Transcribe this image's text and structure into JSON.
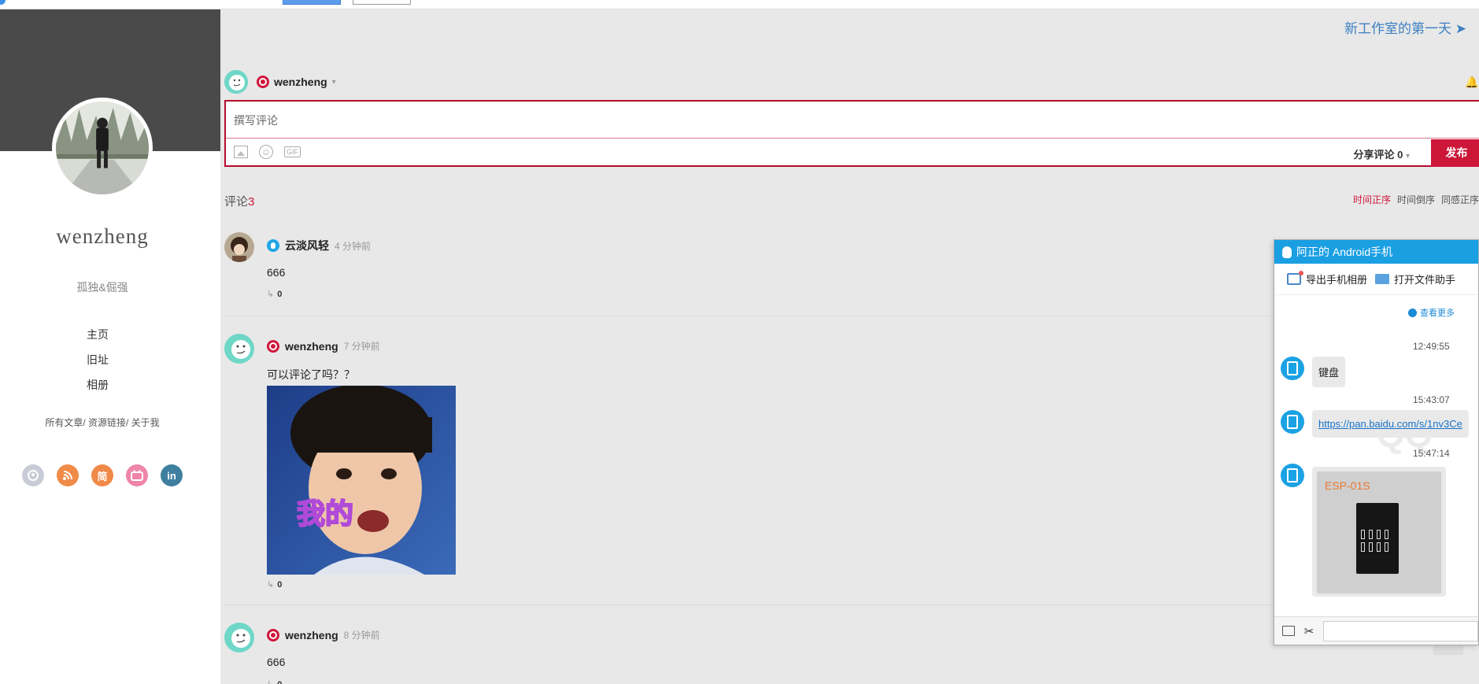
{
  "header": {
    "title_link": "新工作室的第一天"
  },
  "profile": {
    "name": "wenzheng",
    "motto": "孤独&倔强",
    "nav": [
      "主页",
      "旧址",
      "相册"
    ],
    "links": "所有文章/ 资源链接/ 关于我",
    "social": [
      {
        "icon": "github-icon",
        "glyph": "",
        "color": "#c9ccd6"
      },
      {
        "icon": "rss-icon",
        "glyph": "",
        "color": "#f08a48"
      },
      {
        "icon": "jianshu-icon",
        "glyph": "简",
        "color": "#f08a48"
      },
      {
        "icon": "bilibili-icon",
        "glyph": "",
        "color": "#ef85a7"
      },
      {
        "icon": "linkedin-icon",
        "glyph": "in",
        "color": "#3f7f9f"
      }
    ]
  },
  "editor": {
    "username": "wenzheng",
    "placeholder": "撰写评论",
    "gif_label": "GIF",
    "share_label": "分享评论 0",
    "publish_label": "发布"
  },
  "comments_header": {
    "label": "评论",
    "count": "3",
    "sort": [
      "时间正序",
      "时间倒序",
      "同感正序"
    ]
  },
  "comments": [
    {
      "user": "云淡风轻",
      "time": "4 分钟前",
      "text": "666",
      "replies": "0"
    },
    {
      "user": "wenzheng",
      "time": "7 分钟前",
      "text": "可以评论了吗？？",
      "image_caption": "我的",
      "replies": "0"
    },
    {
      "user": "wenzheng",
      "time": "8 分钟前",
      "text": "666",
      "replies": "0"
    }
  ],
  "qq_panel": {
    "title": "阿正的 Android手机",
    "export_label": "导出手机相册",
    "open_label": "打开文件助手",
    "more_label": "查看更多",
    "messages": [
      {
        "time": "12:49:55",
        "text": "键盘"
      },
      {
        "time": "15:43:07",
        "text": "https://pan.baidu.com/s/1nv3Ce"
      },
      {
        "time": "15:47:14",
        "image_label": "ESP-01S"
      }
    ],
    "watermark": "QQ"
  }
}
